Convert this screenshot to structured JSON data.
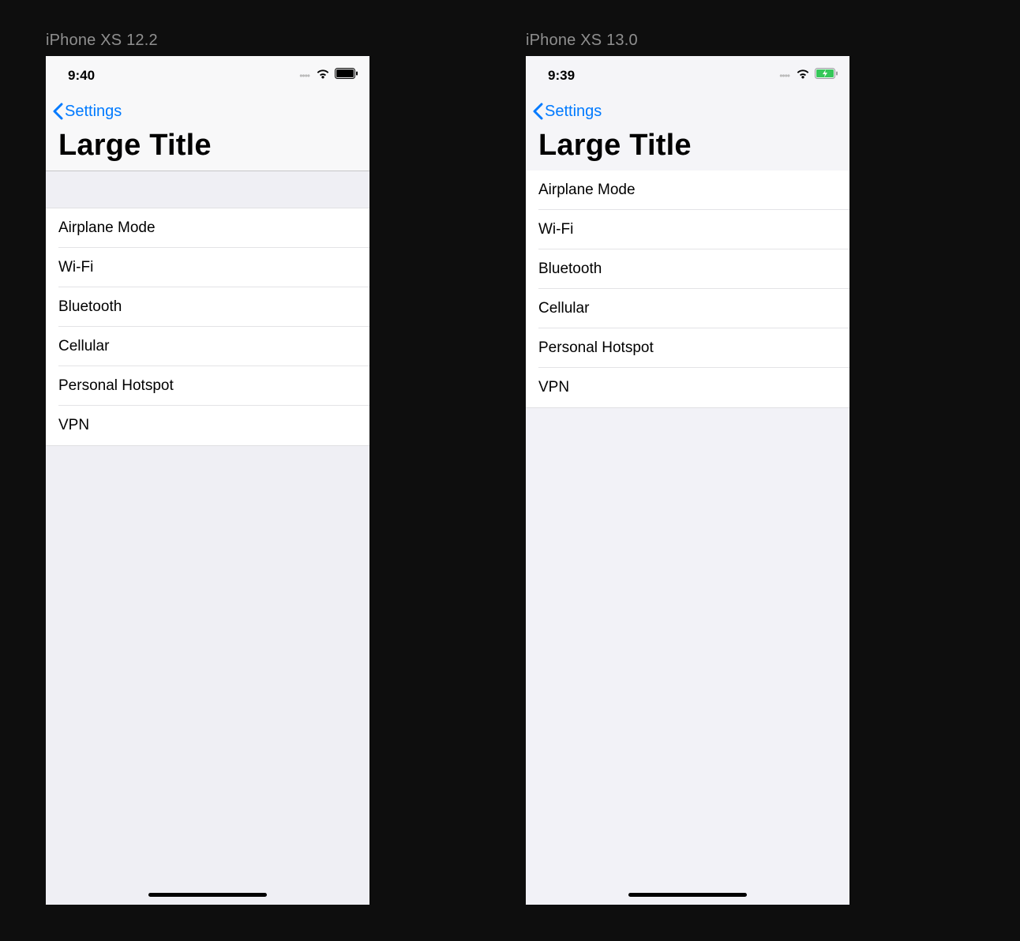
{
  "left": {
    "caption": "iPhone XS 12.2",
    "time": "9:40",
    "back_label": "Settings",
    "title": "Large Title",
    "rows": [
      "Airplane Mode",
      "Wi-Fi",
      "Bluetooth",
      "Cellular",
      "Personal Hotspot",
      "VPN"
    ],
    "battery_charging": false
  },
  "right": {
    "caption": "iPhone XS 13.0",
    "time": "9:39",
    "back_label": "Settings",
    "title": "Large Title",
    "rows": [
      "Airplane Mode",
      "Wi-Fi",
      "Bluetooth",
      "Cellular",
      "Personal Hotspot",
      "VPN"
    ],
    "battery_charging": true
  },
  "colors": {
    "tint": "#007aff",
    "charge_green": "#35c759"
  }
}
